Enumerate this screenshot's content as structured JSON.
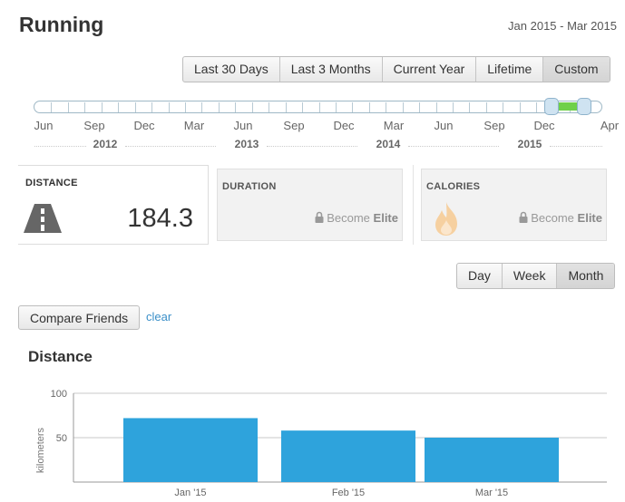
{
  "header": {
    "title": "Running",
    "date_range": "Jan 2015 - Mar 2015"
  },
  "range_buttons": [
    {
      "label": "Last 30 Days",
      "active": false
    },
    {
      "label": "Last 3 Months",
      "active": false
    },
    {
      "label": "Current Year",
      "active": false
    },
    {
      "label": "Lifetime",
      "active": false
    },
    {
      "label": "Custom",
      "active": true
    }
  ],
  "timeline": {
    "months": [
      "Jun",
      "Sep",
      "Dec",
      "Mar",
      "Jun",
      "Sep",
      "Dec",
      "Mar",
      "Jun",
      "Sep",
      "Dec",
      "Apr"
    ],
    "years": [
      "2012",
      "2013",
      "2014",
      "2015"
    ],
    "selection_color": "#6fd04a"
  },
  "stats": {
    "distance": {
      "label": "DISTANCE",
      "value": "184.3",
      "icon": "road-icon"
    },
    "duration": {
      "label": "DURATION",
      "locked_prefix": "Become",
      "locked_word": "Elite",
      "icon": "lock-icon"
    },
    "calories": {
      "label": "CALORIES",
      "locked_prefix": "Become",
      "locked_word": "Elite",
      "icon": "flame-icon"
    }
  },
  "period_buttons": [
    {
      "label": "Day",
      "active": false
    },
    {
      "label": "Week",
      "active": false
    },
    {
      "label": "Month",
      "active": true
    }
  ],
  "compare": {
    "button_label": "Compare Friends",
    "clear_label": "clear"
  },
  "chart_title": "Distance",
  "chart_data": {
    "type": "bar",
    "categories": [
      "Jan '15",
      "Feb '15",
      "Mar '15"
    ],
    "values": [
      72,
      58,
      50
    ],
    "ylabel": "kilometers",
    "yticks": [
      50,
      100
    ],
    "ylim": [
      0,
      100
    ],
    "bar_color": "#2ea3dc",
    "grid": true
  }
}
